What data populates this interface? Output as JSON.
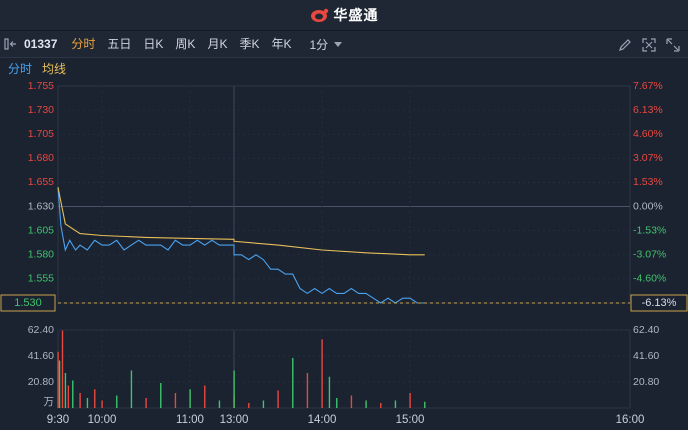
{
  "app": {
    "brand": "华盛通"
  },
  "toolbar": {
    "stock_code": "01337",
    "tabs": [
      "分时",
      "五日",
      "日K",
      "周K",
      "月K",
      "季K",
      "年K"
    ],
    "active_tab": 0,
    "interval": "1分"
  },
  "legend": {
    "price_label": "分时",
    "avg_label": "均线"
  },
  "colors": {
    "up": "#e8483f",
    "down": "#3fc46d",
    "price_line": "#4aa3f0",
    "avg_line": "#e8c05a",
    "accent": "#e8a33d"
  },
  "icons": [
    "panel-toggle-icon",
    "pencil-icon",
    "fullscreen-icon",
    "expand-icon"
  ],
  "chart_data": {
    "type": "line",
    "x_ticks": [
      "9:30",
      "10:00",
      "11:00",
      "13:00",
      "14:00",
      "15:00",
      "16:00"
    ],
    "price_axis": {
      "ylim": [
        1.53,
        1.755
      ],
      "labels": [
        "1.755",
        "1.730",
        "1.705",
        "1.680",
        "1.655",
        "1.630",
        "1.605",
        "1.580",
        "1.555",
        "1.530"
      ],
      "current": "1.530",
      "reference": 1.63
    },
    "pct_axis": {
      "labels": [
        "7.67%",
        "6.13%",
        "4.60%",
        "3.07%",
        "1.53%",
        "0.00%",
        "-1.53%",
        "-3.07%",
        "-4.60%",
        "-6.13%"
      ],
      "current": "-6.13%"
    },
    "volume_axis": {
      "labels": [
        "62.40",
        "41.60",
        "20.80",
        "万"
      ],
      "ylim": [
        0,
        62.4
      ]
    },
    "series": [
      {
        "key": "price",
        "x": [
          "09:30",
          "09:32",
          "09:35",
          "09:38",
          "09:42",
          "09:45",
          "09:50",
          "09:55",
          "10:00",
          "10:05",
          "10:10",
          "10:15",
          "10:20",
          "10:25",
          "10:30",
          "10:35",
          "10:40",
          "10:45",
          "10:50",
          "10:55",
          "11:00",
          "11:05",
          "11:10",
          "11:15",
          "11:20",
          "11:25",
          "11:30",
          "13:00",
          "13:05",
          "13:10",
          "13:15",
          "13:20",
          "13:25",
          "13:30",
          "13:35",
          "13:40",
          "13:45",
          "13:50",
          "13:55",
          "14:00",
          "14:05",
          "14:10",
          "14:15",
          "14:20",
          "14:25",
          "14:30",
          "14:35",
          "14:40",
          "14:45",
          "14:50",
          "14:55",
          "15:00",
          "15:05",
          "15:10"
        ],
        "values": [
          1.65,
          1.61,
          1.585,
          1.595,
          1.585,
          1.59,
          1.585,
          1.595,
          1.59,
          1.59,
          1.595,
          1.585,
          1.59,
          1.595,
          1.59,
          1.59,
          1.59,
          1.585,
          1.595,
          1.59,
          1.59,
          1.595,
          1.59,
          1.595,
          1.59,
          1.59,
          1.59,
          1.58,
          1.58,
          1.575,
          1.58,
          1.575,
          1.565,
          1.565,
          1.56,
          1.56,
          1.545,
          1.54,
          1.545,
          1.54,
          1.545,
          1.54,
          1.54,
          1.545,
          1.54,
          1.54,
          1.535,
          1.53,
          1.535,
          1.53,
          1.535,
          1.535,
          1.53,
          1.53
        ]
      },
      {
        "key": "avg",
        "x": [
          "09:30",
          "09:35",
          "09:45",
          "10:00",
          "10:30",
          "11:00",
          "11:30",
          "13:00",
          "13:30",
          "14:00",
          "14:30",
          "15:00",
          "15:10"
        ],
        "values": [
          1.65,
          1.612,
          1.602,
          1.6,
          1.598,
          1.597,
          1.596,
          1.594,
          1.59,
          1.585,
          1.582,
          1.58,
          1.58
        ]
      }
    ],
    "volume": {
      "x": [
        "09:30",
        "09:31",
        "09:33",
        "09:35",
        "09:37",
        "09:40",
        "09:45",
        "09:50",
        "09:55",
        "10:00",
        "10:10",
        "10:20",
        "10:30",
        "10:40",
        "10:50",
        "11:00",
        "11:10",
        "11:20",
        "11:30",
        "13:00",
        "13:10",
        "13:20",
        "13:30",
        "13:40",
        "13:50",
        "14:00",
        "14:05",
        "14:10",
        "14:20",
        "14:30",
        "14:40",
        "14:50",
        "15:00",
        "15:10"
      ],
      "values": [
        45,
        38,
        62,
        28,
        18,
        22,
        12,
        8,
        15,
        6,
        10,
        30,
        8,
        20,
        12,
        15,
        18,
        6,
        10,
        30,
        4,
        6,
        14,
        40,
        28,
        55,
        25,
        8,
        10,
        6,
        4,
        6,
        12,
        5
      ],
      "direction": [
        "down",
        "up",
        "down",
        "up",
        "down",
        "up",
        "down",
        "up",
        "down",
        "down",
        "up",
        "up",
        "down",
        "up",
        "down",
        "up",
        "down",
        "up",
        "down",
        "up",
        "down",
        "up",
        "down",
        "up",
        "down",
        "down",
        "up",
        "up",
        "down",
        "up",
        "down",
        "up",
        "down",
        "up"
      ]
    }
  }
}
